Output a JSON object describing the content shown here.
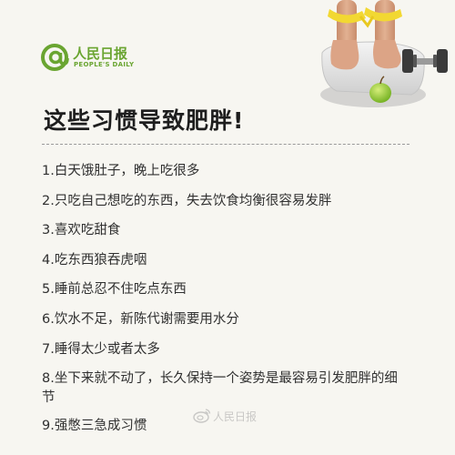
{
  "brand": {
    "name": "人民日报",
    "name_en": "PEOPLE'S DAILY",
    "color": "#6aa531"
  },
  "title": "这些习惯导致肥胖!",
  "habits": [
    "1.白天饿肚子，晚上吃很多",
    "2.只吃自己想吃的东西，失去饮食均衡很容易发胖",
    "3.喜欢吃甜食",
    "4.吃东西狼吞虎咽",
    "5.睡前总忍不住吃点东西",
    "6.饮水不足，新陈代谢需要用水分",
    "7.睡得太少或者太多",
    "8.坐下来就不动了，长久保持一个姿势是最容易引发肥胖的细节",
    "9.强憋三急成习惯"
  ],
  "watermark": {
    "text": "人民日报"
  },
  "icons": {
    "logo": "at-sign-logo-icon",
    "photo": "scale-feet-apple-dumbbell-photo",
    "watermark": "weibo-icon"
  }
}
